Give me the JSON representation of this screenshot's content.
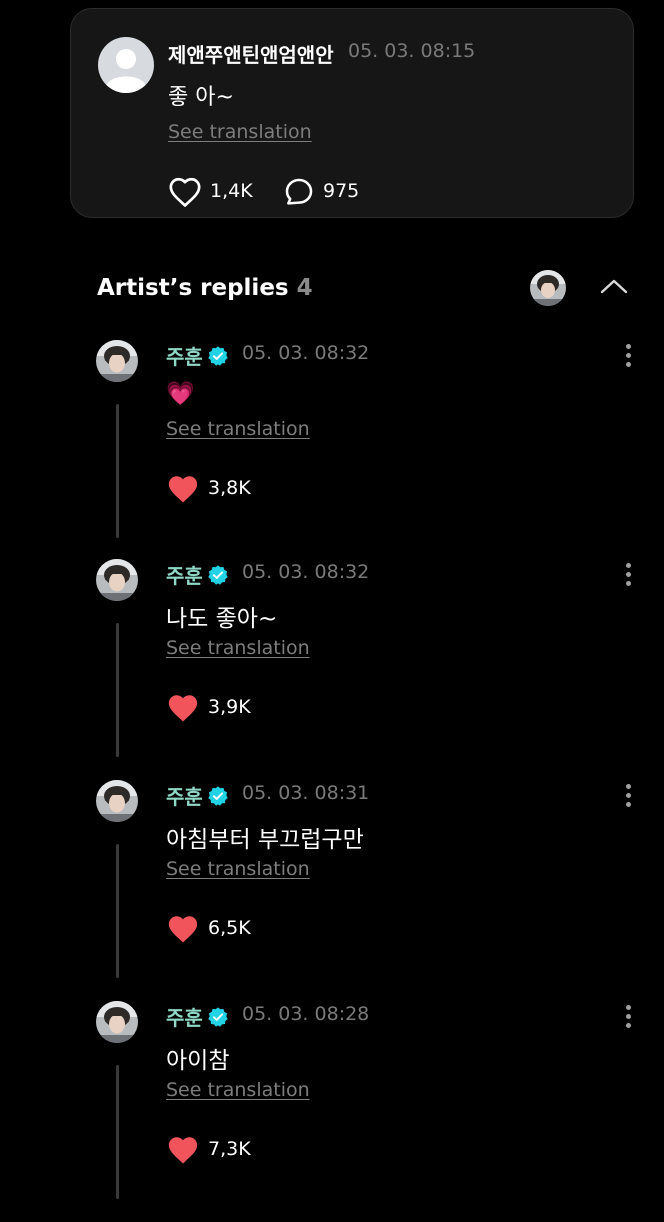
{
  "post": {
    "author": "제앤쭈앤틴앤엄앤안",
    "timestamp": "05. 03. 08:15",
    "text": "좋 아~",
    "translate_label": "See translation",
    "likes": "1,4K",
    "comments": "975",
    "avatar_icon": "default-profile-icon",
    "like_icon": "heart-outline-icon",
    "comment_icon": "speech-bubble-icon"
  },
  "artist_replies": {
    "title": "Artist’s replies",
    "count": "4"
  },
  "replies": [
    {
      "author": "주훈",
      "timestamp": "05. 03. 08:32",
      "text": "💗",
      "translate_label": "See translation",
      "likes": "3,8K"
    },
    {
      "author": "주훈",
      "timestamp": "05. 03. 08:32",
      "text": "나도 좋아~",
      "translate_label": "See translation",
      "likes": "3,9K"
    },
    {
      "author": "주훈",
      "timestamp": "05. 03. 08:31",
      "text": "아침부터 부끄럽구만",
      "translate_label": "See translation",
      "likes": "6,5K"
    },
    {
      "author": "주훈",
      "timestamp": "05. 03. 08:28",
      "text": "아이참",
      "translate_label": "See translation",
      "likes": "7,3K"
    }
  ],
  "colors": {
    "background": "#000000",
    "card": "#161616",
    "artist_name": "#8fd7c6",
    "verified_badge": "#22d3e6",
    "liked_heart": "#f2545b",
    "muted_text": "#7a7a7a"
  }
}
